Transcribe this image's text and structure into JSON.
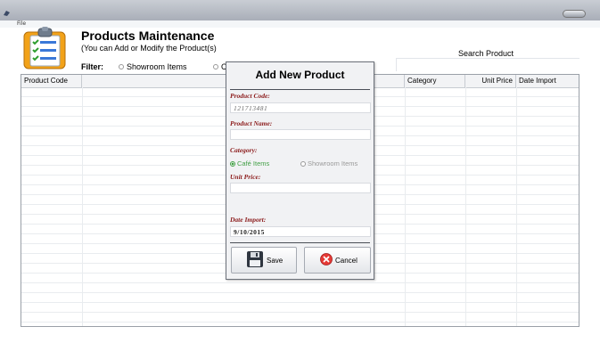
{
  "menu": {
    "file_label": "File"
  },
  "header": {
    "title": "Products Maintenance",
    "subtitle": "(You can Add or Modify the Product(s)",
    "filter_label": "Filter:",
    "filter_options": [
      {
        "label": "Showroom Items",
        "selected": false
      },
      {
        "label": "C",
        "selected": false
      }
    ]
  },
  "search": {
    "label": "Search Product",
    "value": ""
  },
  "grid": {
    "columns": [
      "Product Code",
      "Prod",
      "Category",
      "Unit Price",
      "Date Import"
    ]
  },
  "dialog": {
    "title": "Add New Product",
    "code_label": "Product Code:",
    "code_value": "121713481",
    "name_label": "Product Name:",
    "name_value": "",
    "category_label": "Category:",
    "category_options": [
      {
        "label": "Café Items",
        "selected": true
      },
      {
        "label": "Showroom Items",
        "selected": false
      }
    ],
    "price_label": "Unit Price:",
    "price_value": "",
    "date_label": "Date Import:",
    "date_value": "9/10/2015",
    "save_label": "Save",
    "cancel_label": "Cancel"
  },
  "colors": {
    "accent_selected": "#43a047",
    "field_label": "#8b1a1a",
    "cancel_icon": "#e53935"
  }
}
